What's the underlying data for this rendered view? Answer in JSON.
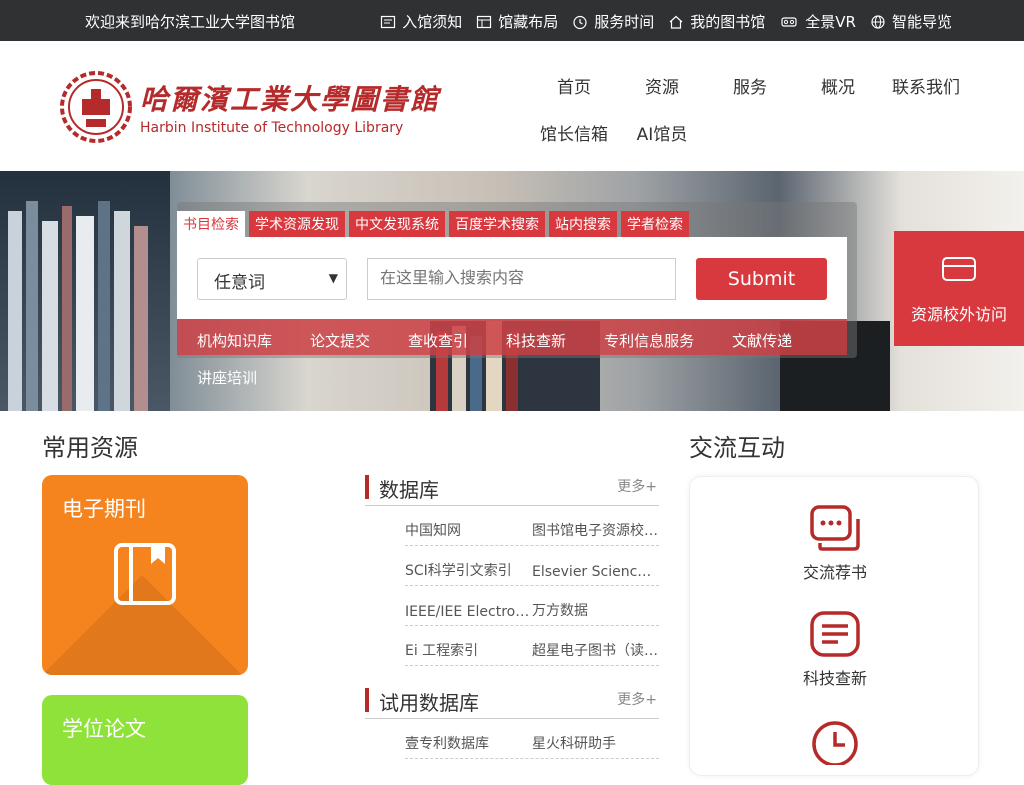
{
  "topbar": {
    "welcome": "欢迎来到哈尔滨工业大学图书馆",
    "links": [
      {
        "label": "入馆须知",
        "icon": "notice-icon"
      },
      {
        "label": "馆藏布局",
        "icon": "layout-icon"
      },
      {
        "label": "服务时间",
        "icon": "clock-icon"
      },
      {
        "label": "我的图书馆",
        "icon": "home-icon"
      },
      {
        "label": "全景VR",
        "icon": "vr-icon"
      },
      {
        "label": "智能导览",
        "icon": "globe-icon"
      }
    ]
  },
  "logo": {
    "cn": "哈爾濱工業大學圖書館",
    "en": "Harbin Institute of Technology Library"
  },
  "nav": [
    "首页",
    "资源",
    "服务",
    "概况",
    "联系我们",
    "馆长信箱",
    "AI馆员"
  ],
  "search": {
    "tabs": [
      "书目检索",
      "学术资源发现",
      "中文发现系统",
      "百度学术搜索",
      "站内搜索",
      "学者检索"
    ],
    "active_tab": 0,
    "select_value": "任意词",
    "placeholder": "在这里输入搜索内容",
    "submit": "Submit",
    "quick_links": [
      "机构知识库",
      "论文提交",
      "查收查引",
      "科技查新",
      "专利信息服务",
      "文献传递",
      "讲座培训"
    ]
  },
  "offcampus": {
    "label": "资源校外访问",
    "icon": "card-icon"
  },
  "resources": {
    "title": "常用资源",
    "cards": [
      {
        "label": "电子期刊",
        "color": "#f5841f",
        "icon": "book-icon"
      },
      {
        "label": "学位论文",
        "color": "#8ee23a"
      }
    ]
  },
  "databases": {
    "title": "数据库",
    "more": "更多+",
    "rows": [
      [
        "中国知网",
        "图书馆电子资源校外访问"
      ],
      [
        "SCI科学引文索引",
        "Elsevier Science Direct"
      ],
      [
        "IEEE/IEE Electronic Library",
        "万方数据"
      ],
      [
        "Ei 工程索引",
        "超星电子图书（读秀）"
      ]
    ]
  },
  "trial_databases": {
    "title": "试用数据库",
    "more": "更多+",
    "rows": [
      [
        "壹专利数据库",
        "星火科研助手"
      ]
    ]
  },
  "interaction": {
    "title": "交流互动",
    "items": [
      {
        "label": "交流荐书",
        "icon": "chat-icon"
      },
      {
        "label": "科技查新",
        "icon": "document-icon"
      },
      {
        "label": "",
        "icon": "clock-icon"
      }
    ]
  },
  "colors": {
    "accent": "#d8393f",
    "brand": "#b52a2a",
    "topbar": "#2f3133"
  }
}
